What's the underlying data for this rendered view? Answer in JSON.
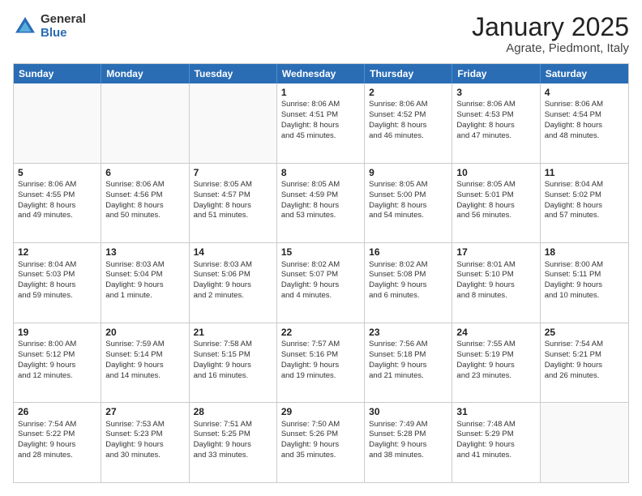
{
  "logo": {
    "general": "General",
    "blue": "Blue"
  },
  "header": {
    "title": "January 2025",
    "subtitle": "Agrate, Piedmont, Italy"
  },
  "weekdays": [
    "Sunday",
    "Monday",
    "Tuesday",
    "Wednesday",
    "Thursday",
    "Friday",
    "Saturday"
  ],
  "weeks": [
    [
      {
        "day": "",
        "info": ""
      },
      {
        "day": "",
        "info": ""
      },
      {
        "day": "",
        "info": ""
      },
      {
        "day": "1",
        "info": "Sunrise: 8:06 AM\nSunset: 4:51 PM\nDaylight: 8 hours\nand 45 minutes."
      },
      {
        "day": "2",
        "info": "Sunrise: 8:06 AM\nSunset: 4:52 PM\nDaylight: 8 hours\nand 46 minutes."
      },
      {
        "day": "3",
        "info": "Sunrise: 8:06 AM\nSunset: 4:53 PM\nDaylight: 8 hours\nand 47 minutes."
      },
      {
        "day": "4",
        "info": "Sunrise: 8:06 AM\nSunset: 4:54 PM\nDaylight: 8 hours\nand 48 minutes."
      }
    ],
    [
      {
        "day": "5",
        "info": "Sunrise: 8:06 AM\nSunset: 4:55 PM\nDaylight: 8 hours\nand 49 minutes."
      },
      {
        "day": "6",
        "info": "Sunrise: 8:06 AM\nSunset: 4:56 PM\nDaylight: 8 hours\nand 50 minutes."
      },
      {
        "day": "7",
        "info": "Sunrise: 8:05 AM\nSunset: 4:57 PM\nDaylight: 8 hours\nand 51 minutes."
      },
      {
        "day": "8",
        "info": "Sunrise: 8:05 AM\nSunset: 4:59 PM\nDaylight: 8 hours\nand 53 minutes."
      },
      {
        "day": "9",
        "info": "Sunrise: 8:05 AM\nSunset: 5:00 PM\nDaylight: 8 hours\nand 54 minutes."
      },
      {
        "day": "10",
        "info": "Sunrise: 8:05 AM\nSunset: 5:01 PM\nDaylight: 8 hours\nand 56 minutes."
      },
      {
        "day": "11",
        "info": "Sunrise: 8:04 AM\nSunset: 5:02 PM\nDaylight: 8 hours\nand 57 minutes."
      }
    ],
    [
      {
        "day": "12",
        "info": "Sunrise: 8:04 AM\nSunset: 5:03 PM\nDaylight: 8 hours\nand 59 minutes."
      },
      {
        "day": "13",
        "info": "Sunrise: 8:03 AM\nSunset: 5:04 PM\nDaylight: 9 hours\nand 1 minute."
      },
      {
        "day": "14",
        "info": "Sunrise: 8:03 AM\nSunset: 5:06 PM\nDaylight: 9 hours\nand 2 minutes."
      },
      {
        "day": "15",
        "info": "Sunrise: 8:02 AM\nSunset: 5:07 PM\nDaylight: 9 hours\nand 4 minutes."
      },
      {
        "day": "16",
        "info": "Sunrise: 8:02 AM\nSunset: 5:08 PM\nDaylight: 9 hours\nand 6 minutes."
      },
      {
        "day": "17",
        "info": "Sunrise: 8:01 AM\nSunset: 5:10 PM\nDaylight: 9 hours\nand 8 minutes."
      },
      {
        "day": "18",
        "info": "Sunrise: 8:00 AM\nSunset: 5:11 PM\nDaylight: 9 hours\nand 10 minutes."
      }
    ],
    [
      {
        "day": "19",
        "info": "Sunrise: 8:00 AM\nSunset: 5:12 PM\nDaylight: 9 hours\nand 12 minutes."
      },
      {
        "day": "20",
        "info": "Sunrise: 7:59 AM\nSunset: 5:14 PM\nDaylight: 9 hours\nand 14 minutes."
      },
      {
        "day": "21",
        "info": "Sunrise: 7:58 AM\nSunset: 5:15 PM\nDaylight: 9 hours\nand 16 minutes."
      },
      {
        "day": "22",
        "info": "Sunrise: 7:57 AM\nSunset: 5:16 PM\nDaylight: 9 hours\nand 19 minutes."
      },
      {
        "day": "23",
        "info": "Sunrise: 7:56 AM\nSunset: 5:18 PM\nDaylight: 9 hours\nand 21 minutes."
      },
      {
        "day": "24",
        "info": "Sunrise: 7:55 AM\nSunset: 5:19 PM\nDaylight: 9 hours\nand 23 minutes."
      },
      {
        "day": "25",
        "info": "Sunrise: 7:54 AM\nSunset: 5:21 PM\nDaylight: 9 hours\nand 26 minutes."
      }
    ],
    [
      {
        "day": "26",
        "info": "Sunrise: 7:54 AM\nSunset: 5:22 PM\nDaylight: 9 hours\nand 28 minutes."
      },
      {
        "day": "27",
        "info": "Sunrise: 7:53 AM\nSunset: 5:23 PM\nDaylight: 9 hours\nand 30 minutes."
      },
      {
        "day": "28",
        "info": "Sunrise: 7:51 AM\nSunset: 5:25 PM\nDaylight: 9 hours\nand 33 minutes."
      },
      {
        "day": "29",
        "info": "Sunrise: 7:50 AM\nSunset: 5:26 PM\nDaylight: 9 hours\nand 35 minutes."
      },
      {
        "day": "30",
        "info": "Sunrise: 7:49 AM\nSunset: 5:28 PM\nDaylight: 9 hours\nand 38 minutes."
      },
      {
        "day": "31",
        "info": "Sunrise: 7:48 AM\nSunset: 5:29 PM\nDaylight: 9 hours\nand 41 minutes."
      },
      {
        "day": "",
        "info": ""
      }
    ]
  ]
}
